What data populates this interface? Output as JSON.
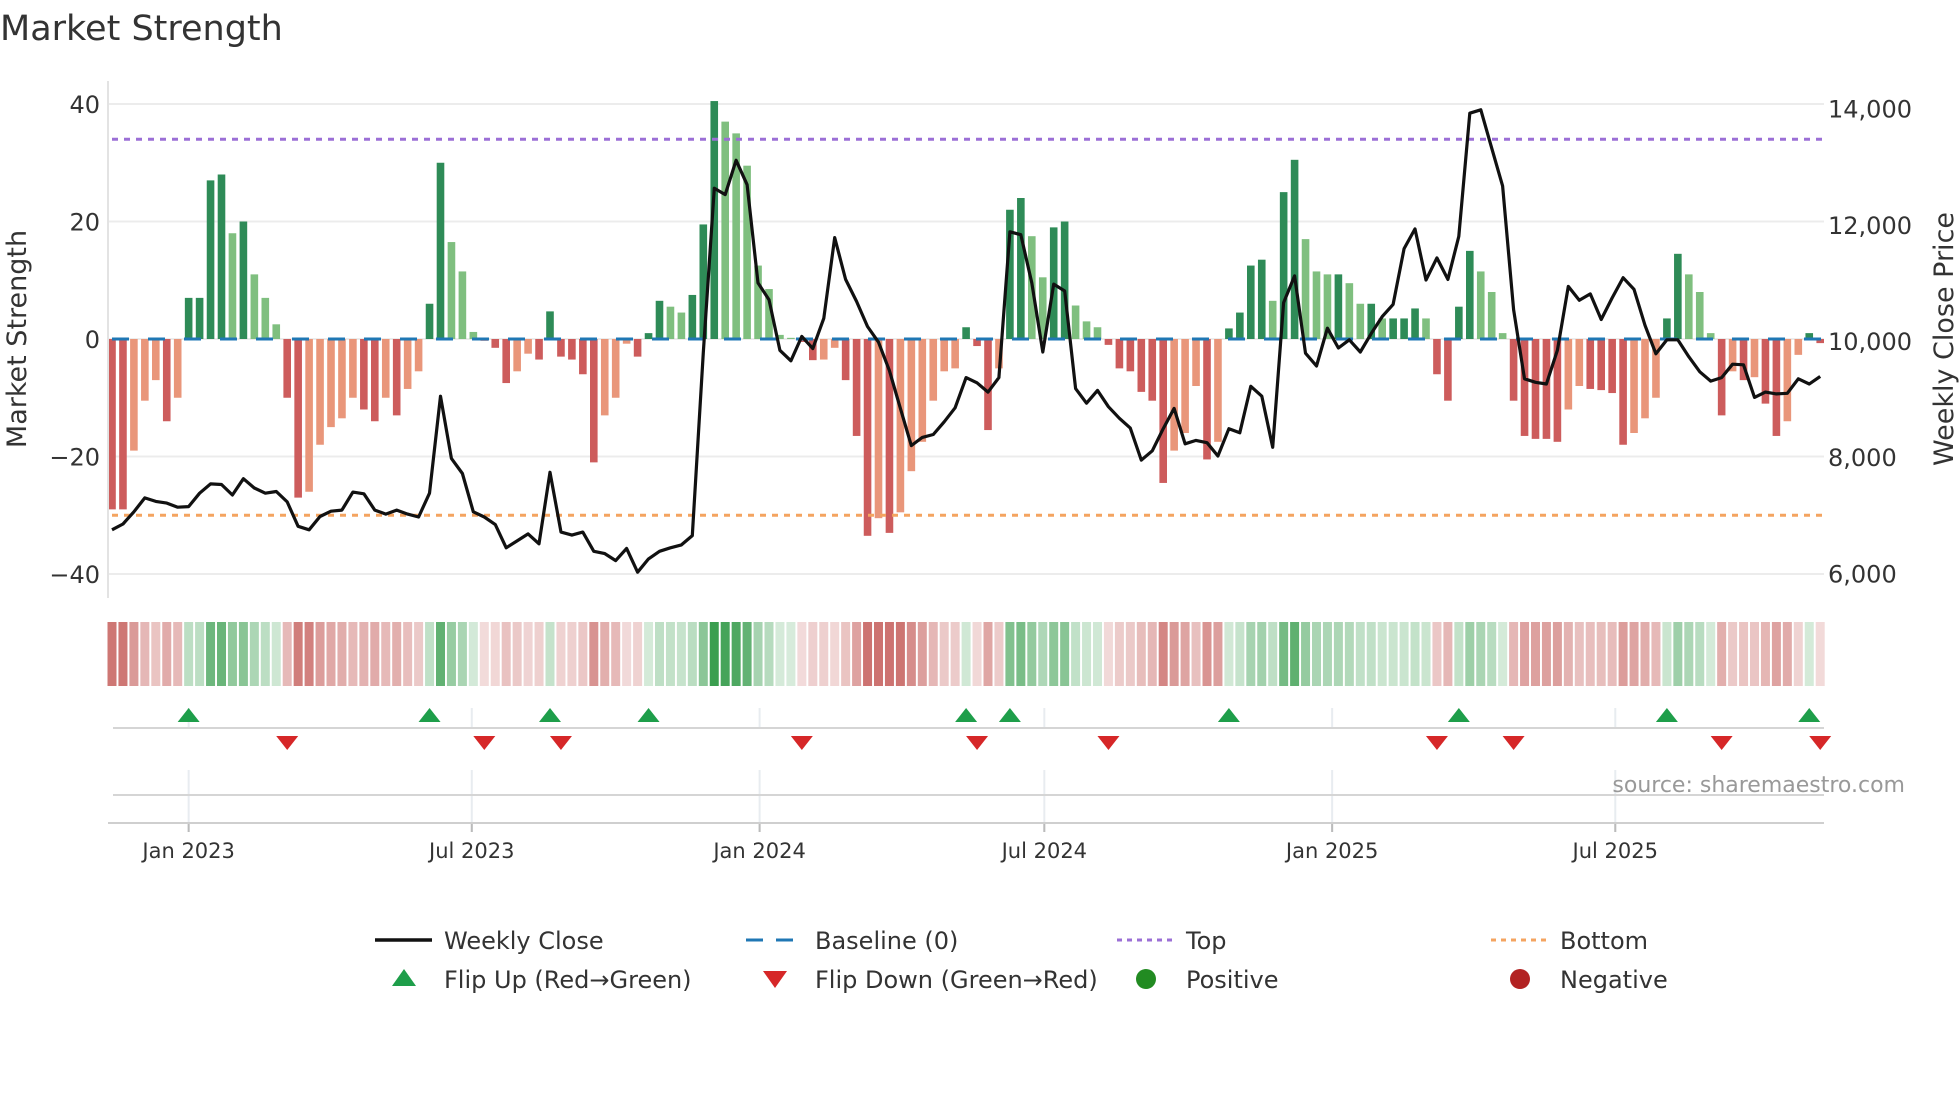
{
  "title": "Market Strength",
  "source": "source: sharemaestro.com",
  "chart_data": {
    "type": "bar",
    "title": "Market Strength",
    "x_start": "2022-11-13",
    "x_step_days": 7,
    "ylabel": "Market Strength",
    "y2label": "Weekly Close Price",
    "ylim": [
      -44,
      44
    ],
    "y2lim": [
      5570,
      14480
    ],
    "grid": true,
    "top_level": 34,
    "bottom_level": -30,
    "baseline": 0,
    "left_axis": {
      "ticks": [
        {
          "v": 40,
          "label": "40"
        },
        {
          "v": 20,
          "label": "20"
        },
        {
          "v": 0,
          "label": "0"
        },
        {
          "v": -20,
          "label": "−20"
        },
        {
          "v": -40,
          "label": "−40"
        }
      ]
    },
    "right_axis": {
      "ticks": [
        {
          "v": 14000,
          "label": "14,000"
        },
        {
          "v": 12000,
          "label": "12,000"
        },
        {
          "v": 10000,
          "label": "10,000"
        },
        {
          "v": 8000,
          "label": "8,000"
        },
        {
          "v": 6000,
          "label": "6,000"
        }
      ]
    },
    "x_ticks": [
      {
        "date": "2023-01-01",
        "label": "Jan 2023"
      },
      {
        "date": "2023-07-01",
        "label": "Jul 2023"
      },
      {
        "date": "2024-01-01",
        "label": "Jan 2024"
      },
      {
        "date": "2024-07-01",
        "label": "Jul 2024"
      },
      {
        "date": "2025-01-01",
        "label": "Jan 2025"
      },
      {
        "date": "2025-07-01",
        "label": "Jul 2025"
      }
    ],
    "strength": [
      -29,
      -29,
      -19,
      -10.5,
      -7,
      -14,
      -10,
      7,
      7,
      27,
      28,
      18,
      20,
      11,
      7,
      2.5,
      -10,
      -27,
      -26,
      -18,
      -15,
      -13.5,
      -10,
      -12,
      -14,
      -10,
      -13,
      -8.5,
      -5.5,
      6,
      30,
      16.5,
      11.5,
      1.2,
      -0.3,
      -1.5,
      -7.5,
      -5.5,
      -2.5,
      -3.5,
      4.7,
      -3,
      -3.5,
      -6,
      -21,
      -13,
      -10,
      -0.8,
      -3,
      1,
      6.5,
      5.5,
      4.5,
      7.5,
      19.5,
      40.5,
      37,
      35,
      29.5,
      12.5,
      8.5,
      0.7,
      0.2,
      -0.5,
      -3.6,
      -3.5,
      -1.5,
      -7,
      -16.5,
      -33.5,
      -30.5,
      -33,
      -29.5,
      -22.5,
      -17.5,
      -10.5,
      -5.5,
      -5,
      2,
      -1.2,
      -15.5,
      -5,
      22,
      24,
      17.5,
      10.5,
      19,
      20,
      5.7,
      3,
      2,
      -1,
      -5,
      -5.5,
      -9,
      -10.5,
      -24.5,
      -19,
      -16,
      -8,
      -20.5,
      -17.5,
      1.8,
      4.5,
      12.5,
      13.5,
      6.5,
      25,
      30.5,
      17,
      11.5,
      11,
      11,
      9.5,
      6,
      6,
      3.5,
      3.5,
      3.5,
      5.2,
      3.5,
      -6,
      -10.5,
      5.5,
      15,
      11.5,
      8,
      1,
      -10.5,
      -16.5,
      -17,
      -17,
      -17.5,
      -12,
      -8,
      -8.5,
      -8.7,
      -9.2,
      -18,
      -16,
      -13.5,
      -10,
      3.5,
      14.5,
      11,
      8,
      1,
      -13,
      -5.5,
      -7,
      -6.5,
      -11,
      -16.5,
      -14,
      -2.7,
      1,
      -0.7
    ],
    "weekly_close": [
      6750,
      6850,
      7060,
      7300,
      7240,
      7210,
      7140,
      7150,
      7380,
      7540,
      7530,
      7350,
      7630,
      7470,
      7380,
      7410,
      7230,
      6810,
      6750,
      6980,
      7070,
      7090,
      7400,
      7370,
      7090,
      7020,
      7090,
      7020,
      6970,
      7380,
      9050,
      7980,
      7720,
      7060,
      6970,
      6840,
      6440,
      6560,
      6680,
      6510,
      7740,
      6710,
      6660,
      6710,
      6380,
      6340,
      6220,
      6430,
      6020,
      6250,
      6380,
      6440,
      6490,
      6650,
      9800,
      12630,
      12520,
      13110,
      12690,
      11000,
      10710,
      9840,
      9660,
      10080,
      9870,
      10390,
      11780,
      11060,
      10680,
      10250,
      9980,
      9490,
      8840,
      8200,
      8340,
      8390,
      8610,
      8850,
      9370,
      9280,
      9120,
      9370,
      11880,
      11830,
      11000,
      9810,
      10980,
      10860,
      9180,
      8930,
      9150,
      8870,
      8670,
      8500,
      7950,
      8110,
      8490,
      8840,
      8230,
      8290,
      8250,
      8020,
      8490,
      8420,
      9220,
      9050,
      8170,
      10660,
      11120,
      9790,
      9570,
      10220,
      9880,
      10020,
      9810,
      10130,
      10420,
      10630,
      11590,
      11930,
      11050,
      11430,
      11060,
      11800,
      13920,
      13980,
      13320,
      12670,
      10540,
      9350,
      9290,
      9260,
      9840,
      10940,
      10700,
      10810,
      10370,
      10740,
      11090,
      10890,
      10270,
      9780,
      10020,
      10020,
      9730,
      9470,
      9310,
      9370,
      9600,
      9590,
      9030,
      9120,
      9090,
      9100,
      9350,
      9260,
      9390
    ],
    "flips": {
      "up_weeks": [
        7,
        29,
        40,
        49,
        78,
        82,
        102,
        123,
        142,
        155
      ],
      "down_weeks": [
        16,
        34,
        41,
        63,
        79,
        91,
        121,
        128,
        147,
        156
      ]
    },
    "legend": {
      "placement": "bottom",
      "items": [
        {
          "label": "Weekly Close",
          "kind": "line",
          "color": "#111111"
        },
        {
          "label": "Baseline (0)",
          "kind": "dash",
          "color": "#1f77b4"
        },
        {
          "label": "Top",
          "kind": "dot",
          "color": "#9b6fd6"
        },
        {
          "label": "Bottom",
          "kind": "dot",
          "color": "#f4a460"
        },
        {
          "label": "Flip Up (Red→Green)",
          "kind": "tri-up",
          "color": "#1e9e4a"
        },
        {
          "label": "Flip Down (Green→Red)",
          "kind": "tri-down",
          "color": "#d62728"
        },
        {
          "label": "Positive",
          "kind": "dot-marker",
          "color": "#228b22"
        },
        {
          "label": "Negative",
          "kind": "dot-marker",
          "color": "#b22222"
        }
      ]
    },
    "colors": {
      "pos_strong": "#2e8b57",
      "pos_weak": "#7fbf7f",
      "neg_strong": "#cd5c5c",
      "neg_weak": "#e9967a",
      "strip_pos": "#3a9e4f",
      "strip_neg": "#c0504d"
    }
  }
}
